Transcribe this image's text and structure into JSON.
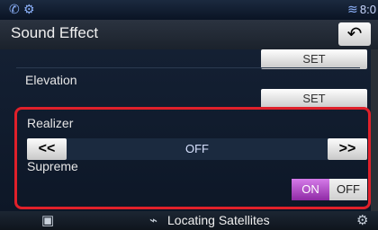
{
  "statusbar": {
    "time": "8:0"
  },
  "header": {
    "title": "Sound Effect",
    "back_label": "↶"
  },
  "rows": {
    "top_set_label": "SET",
    "elevation_label": "Elevation",
    "elevation_set_label": "SET",
    "realizer_label": "Realizer",
    "realizer_prev": "<<",
    "realizer_value": "OFF",
    "realizer_next": ">>",
    "supreme_label": "Supreme",
    "supreme_on": "ON",
    "supreme_off": "OFF"
  },
  "bottom": {
    "status_text": "Locating Satellites"
  },
  "icons": {
    "status_left": [
      "phone-icon",
      "wifi-signal-icon"
    ],
    "status_right": "signal-icon",
    "bottom_left": "camera-icon",
    "bottom_center": "antenna-icon",
    "bottom_right": "gear-icon"
  },
  "colors": {
    "accent_on": "#b24ad0",
    "highlight": "#e0202a"
  }
}
